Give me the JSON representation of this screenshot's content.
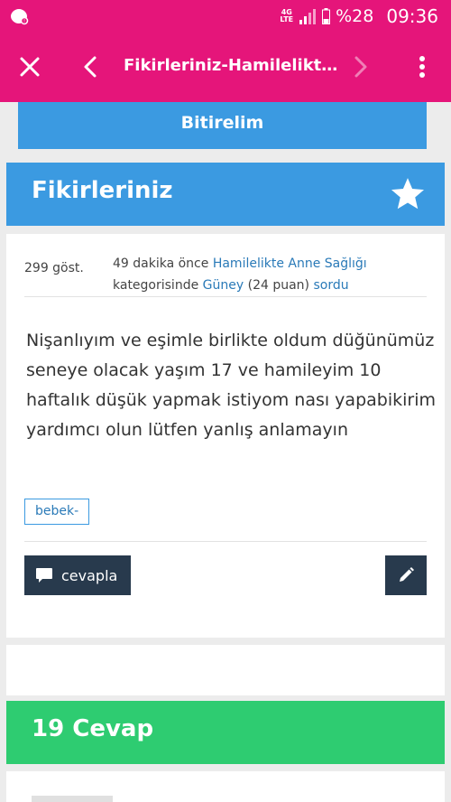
{
  "status_bar": {
    "network": "4G",
    "network_sub": "LTE",
    "battery": "%28",
    "time": "09:36",
    "icons": [
      "app-notification-icon",
      "signal-icon",
      "battery-icon"
    ]
  },
  "toolbar": {
    "title": "Fikirleriniz-Hamilelikte A...",
    "icons": [
      "close-icon",
      "back-arrow-icon",
      "forward-arrow-icon",
      "more-vert-icon"
    ]
  },
  "banner": {
    "text": "Bitirelim"
  },
  "question_section": {
    "title": "Fikirleriniz",
    "star_icon": "star-icon"
  },
  "question": {
    "views": "299 göst.",
    "time_ago": "49 dakika önce",
    "category": "Hamilelikte Anne Sağlığı",
    "category_suffix": "kategorisinde",
    "author": "Güney",
    "points": "(24 puan)",
    "action": "sordu",
    "text": "Nişanlıyım ve eşimle birlikte oldum düğünümüz seneye olacak yaşım 17  ve hamileyim 10 haftalık düşük yapmak istiyom nası yapabikirim yardımcı olun lütfen yanlış anlamayın",
    "tag": "bebek-",
    "answer_button": "cevapla",
    "icons": [
      "comment-icon",
      "edit-pencil-icon"
    ]
  },
  "answers_section": {
    "title": "19 Cevap"
  },
  "colors": {
    "primary": "#e5157a",
    "blue": "#3b9ae1",
    "green": "#2ecc71",
    "dark_button": "#283a4d",
    "link": "#2a7ab8"
  }
}
